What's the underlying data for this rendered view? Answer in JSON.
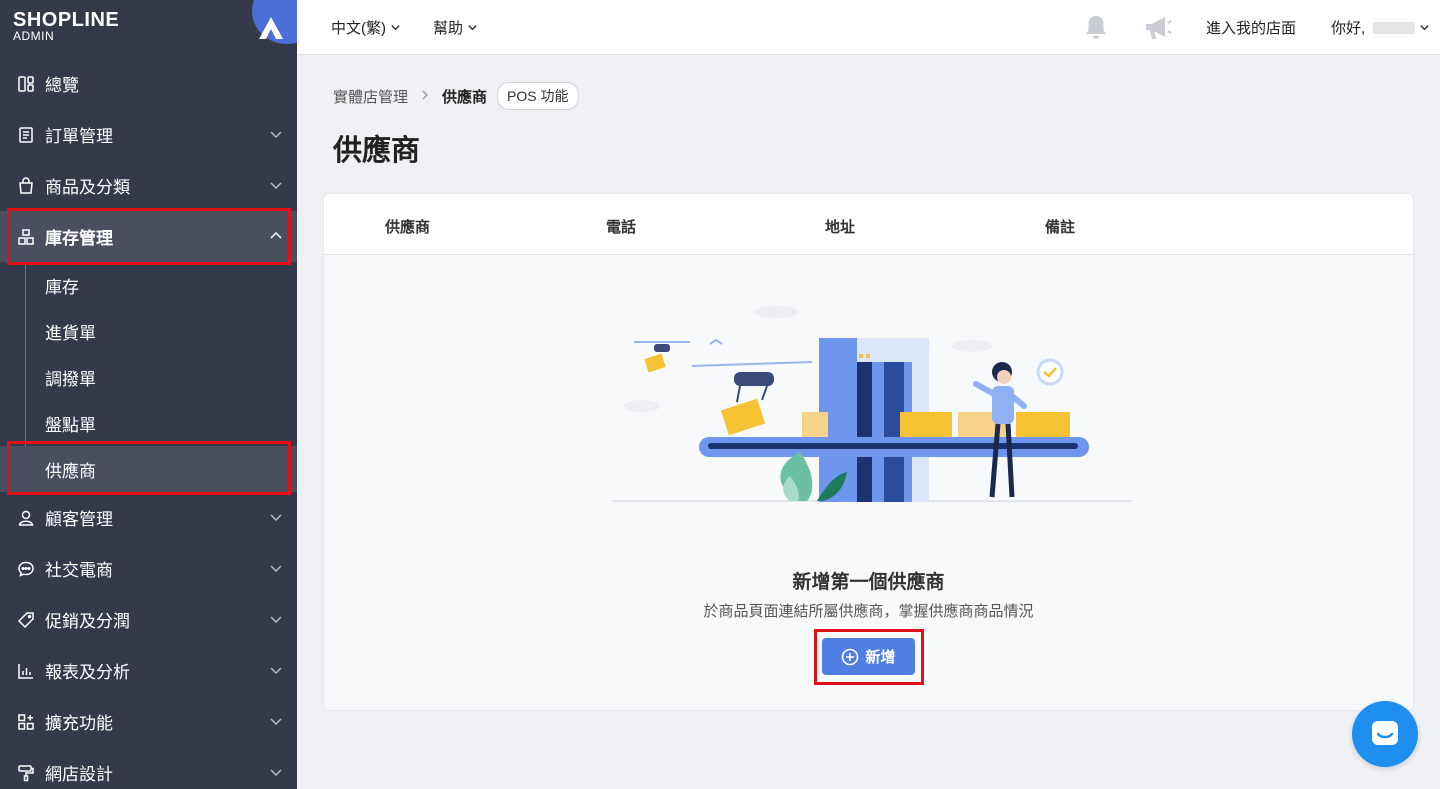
{
  "brand": {
    "name": "SHOPLINE",
    "sub": "ADMIN"
  },
  "sidebar": {
    "items": [
      {
        "label": "總覽",
        "icon": "dashboard-icon"
      },
      {
        "label": "訂單管理",
        "icon": "order-icon"
      },
      {
        "label": "商品及分類",
        "icon": "bag-icon"
      },
      {
        "label": "庫存管理",
        "icon": "inventory-icon"
      },
      {
        "label": "顧客管理",
        "icon": "user-icon"
      },
      {
        "label": "社交電商",
        "icon": "chat-icon"
      },
      {
        "label": "促銷及分潤",
        "icon": "tag-icon"
      },
      {
        "label": "報表及分析",
        "icon": "chart-icon"
      },
      {
        "label": "擴充功能",
        "icon": "apps-icon"
      },
      {
        "label": "網店設計",
        "icon": "paint-icon"
      }
    ],
    "inventory_sub": [
      "庫存",
      "進貨單",
      "調撥單",
      "盤點單",
      "供應商"
    ]
  },
  "header": {
    "language": "中文(繁)",
    "help": "幫助",
    "visit_store": "進入我的店面",
    "greeting": "你好,"
  },
  "breadcrumb": {
    "parent": "實體店管理",
    "current": "供應商",
    "badge": "POS 功能"
  },
  "page": {
    "title": "供應商"
  },
  "table": {
    "columns": [
      "供應商",
      "電話",
      "地址",
      "備註"
    ]
  },
  "empty": {
    "title": "新增第一個供應商",
    "desc": "於商品頁面連結所屬供應商，掌握供應商商品情況",
    "button": "新增"
  },
  "colors": {
    "sidebar": "#353a4b",
    "accent": "#4f7fe3",
    "highlight": "#e3101a"
  }
}
